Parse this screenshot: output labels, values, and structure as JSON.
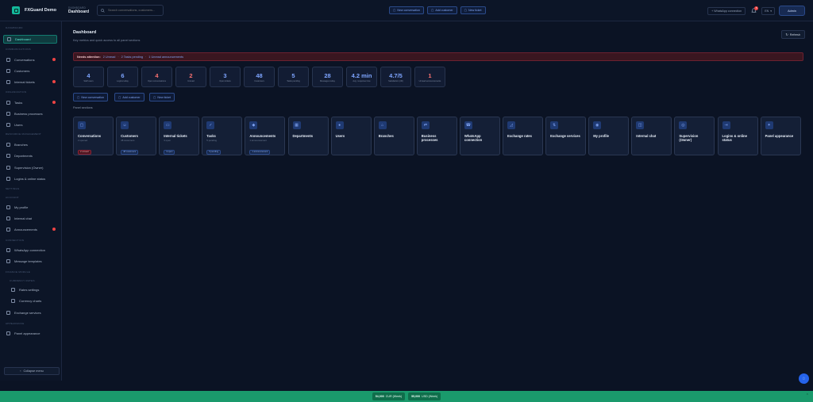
{
  "app": {
    "brand": "FXGuard Demo",
    "crumb_small": "DASHBOARD",
    "crumb_page": "Dashboard"
  },
  "search": {
    "placeholder": "Search conversations, customers..."
  },
  "top_actions": [
    {
      "label": "New conversation"
    },
    {
      "label": "Add customer"
    },
    {
      "label": "New ticket"
    }
  ],
  "topbar_right": {
    "whatsapp_label": "+ WhatsApp connection",
    "notif_count": "5",
    "lang": "EN",
    "user": "Admin"
  },
  "sidebar": {
    "sections": [
      {
        "title": "DASHBOARD",
        "items": [
          {
            "label": "Dashboard",
            "active": true
          }
        ]
      },
      {
        "title": "COMMUNICATIONS",
        "items": [
          {
            "label": "Conversations",
            "badge": true
          },
          {
            "label": "Customers"
          },
          {
            "label": "Internal tickets",
            "badge": true
          }
        ]
      },
      {
        "title": "ORGANIZATION",
        "items": [
          {
            "label": "Tasks",
            "badge": true
          },
          {
            "label": "Business processes"
          },
          {
            "label": "Users"
          }
        ]
      },
      {
        "title": "RESOURCE MANAGEMENT",
        "items": [
          {
            "label": "Branches"
          },
          {
            "label": "Departments"
          },
          {
            "label": "Supervision (Owner)"
          },
          {
            "label": "Logins & online status"
          }
        ]
      },
      {
        "title": "SETTINGS",
        "items": []
      },
      {
        "title": "ACCOUNT",
        "items": [
          {
            "label": "My profile"
          },
          {
            "label": "Internal chat"
          },
          {
            "label": "Announcements",
            "badge": true
          }
        ]
      },
      {
        "title": "CONNECTION",
        "items": [
          {
            "label": "WhatsApp connection"
          },
          {
            "label": "Message templates"
          }
        ]
      },
      {
        "title": "FINANCE MODULE",
        "items": []
      },
      {
        "title": "CURRENCY RATES",
        "items": [
          {
            "label": "Rates settings",
            "sub": true
          },
          {
            "label": "Currency charts",
            "sub": true
          },
          {
            "label": "Exchange services"
          }
        ]
      },
      {
        "title": "APPEARANCE",
        "items": [
          {
            "label": "Panel appearance"
          }
        ]
      }
    ],
    "collapse_label": "Collapse menu"
  },
  "main": {
    "title": "Dashboard",
    "subtitle": "Key metrics and quick access to all panel sections",
    "refresh_label": "Refresh",
    "alert": {
      "label": "Needs attention:",
      "links": [
        "2 Unread",
        "2 Tasks pending",
        "1 Unread announcements"
      ]
    },
    "stats": [
      {
        "value": "4",
        "label": "Staff users",
        "red": false
      },
      {
        "value": "6",
        "label": "Logins today",
        "red": false
      },
      {
        "value": "4",
        "label": "Open conversations",
        "red": true
      },
      {
        "value": "2",
        "label": "Unread",
        "red": true
      },
      {
        "value": "3",
        "label": "Open tickets",
        "red": false
      },
      {
        "value": "48",
        "label": "Customers",
        "red": false
      },
      {
        "value": "5",
        "label": "Tasks pending",
        "red": false
      },
      {
        "value": "28",
        "label": "Messages today",
        "red": false
      },
      {
        "value": "4.2 min",
        "label": "Avg. response time",
        "red": false
      },
      {
        "value": "4.7/5",
        "label": "Satisfaction (30)",
        "red": false
      },
      {
        "value": "1",
        "label": "Unread announcements",
        "red": true
      }
    ],
    "quick_actions": [
      {
        "label": "New conversation"
      },
      {
        "label": "Add customer"
      },
      {
        "label": "New ticket"
      }
    ],
    "sections_heading": "Panel sections",
    "cards": [
      {
        "title": "Conversations",
        "icon": "chat-icon",
        "sub": "2 opened",
        "pill": "2 unread",
        "pill_red": true
      },
      {
        "title": "Customers",
        "icon": "users-icon",
        "sub": "48 customers",
        "pill": "48 customers"
      },
      {
        "title": "Internal tickets",
        "icon": "ticket-icon",
        "sub": "3 open",
        "pill": "3 open"
      },
      {
        "title": "Tasks",
        "icon": "check-icon",
        "sub": "5 pending",
        "pill": "5 pending"
      },
      {
        "title": "Announcements",
        "icon": "megaphone-icon",
        "sub": "1 announcement",
        "pill": "1 announcement"
      },
      {
        "title": "Departments",
        "icon": "building-icon"
      },
      {
        "title": "Users",
        "icon": "user-icon"
      },
      {
        "title": "Branches",
        "icon": "branch-icon"
      },
      {
        "title": "Business processes",
        "icon": "process-icon"
      },
      {
        "title": "WhatsApp connection",
        "icon": "phone-icon"
      },
      {
        "title": "Exchange rates",
        "icon": "chart-icon"
      },
      {
        "title": "Exchange services",
        "icon": "exchange-icon"
      },
      {
        "title": "My profile",
        "icon": "profile-icon"
      },
      {
        "title": "Internal chat",
        "icon": "message-icon"
      },
      {
        "title": "Supervision (Owner)",
        "icon": "eye-icon"
      },
      {
        "title": "Logins & online status",
        "icon": "login-icon"
      },
      {
        "title": "Panel appearance",
        "icon": "palette-icon"
      }
    ]
  },
  "ticker": [
    {
      "value": "54,000",
      "unit": "CUR (Week)"
    },
    {
      "value": "55,000",
      "unit": "USD (Week)"
    }
  ],
  "colors": {
    "accent": "#14b89c",
    "link": "#7fa2f0",
    "danger": "#ef4444",
    "ticker": "#1a9a6c"
  }
}
